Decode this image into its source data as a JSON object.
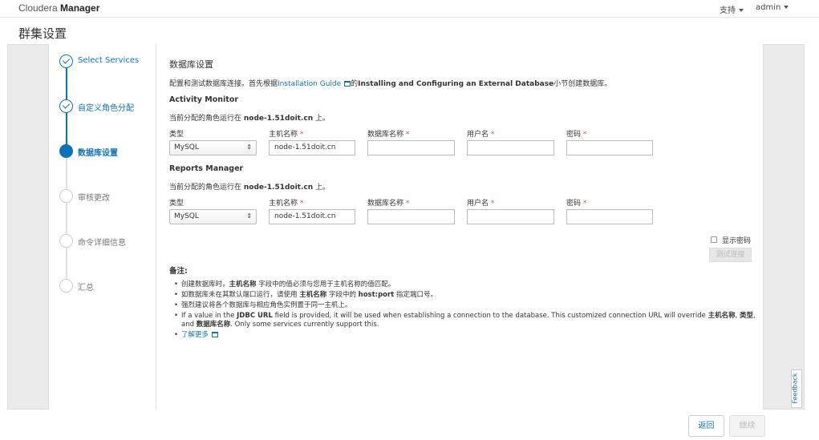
{
  "header": {
    "brand_light": "Cloudera",
    "brand_bold": "Manager",
    "support_label": "支持",
    "user_label": "admin"
  },
  "page_title": "群集设置",
  "steps": [
    {
      "label": "Select Services",
      "state": "done"
    },
    {
      "label": "自定义角色分配",
      "state": "done"
    },
    {
      "label": "数据库设置",
      "state": "active"
    },
    {
      "label": "审核更改",
      "state": "pending"
    },
    {
      "label": "命令详细信息",
      "state": "pending"
    },
    {
      "label": "汇总",
      "state": "pending"
    }
  ],
  "main": {
    "heading": "数据库设置",
    "intro_prefix": "配置和测试数据库连接。首先根据",
    "intro_link": "Installation Guide",
    "intro_mid": "的",
    "intro_bold": "Installing and Configuring an External Database",
    "intro_suffix": "小节创建数据库。",
    "field_labels": {
      "type": "类型",
      "host": "主机名称",
      "db_name": "数据库名称",
      "username": "用户名",
      "password": "密码",
      "required_mark": "*"
    },
    "sections": [
      {
        "title": "Activity Monitor",
        "host_prefix": "当前分配的角色运行在",
        "host_node": "node-1.51doit.cn",
        "host_suffix": "上。",
        "type_value": "MySQL",
        "host_value": "node-1.51doit.cn",
        "db_value": "",
        "user_value": "",
        "password_value": ""
      },
      {
        "title": "Reports Manager",
        "host_prefix": "当前分配的角色运行在",
        "host_node": "node-1.51doit.cn",
        "host_suffix": "上。",
        "type_value": "MySQL",
        "host_value": "node-1.51doit.cn",
        "db_value": "",
        "user_value": "",
        "password_value": ""
      }
    ],
    "show_password_label": "显示密码",
    "test_connection_label": "测试连接",
    "notes_title": "备注:",
    "notes": {
      "n1_a": "创建数据库时，",
      "n1_b": "主机名称",
      "n1_c": "字段中的值必须与您用于主机名称的值匹配。",
      "n2_a": "如数据库未在其默认端口运行，请使用",
      "n2_b": "主机名称",
      "n2_c": "字段中的",
      "n2_d": "host:port",
      "n2_e": "指定端口号。",
      "n3": "强烈建议将各个数据库与相应角色实例置于同一主机上。",
      "n4_a": "If a value in the",
      "n4_b": "JDBC URL",
      "n4_c": "field is provided, it will be used when establishing a connection to the database. This customized connection URL will override",
      "n4_d": "主机名称",
      "n4_e": ",",
      "n4_f": "类型",
      "n4_g": ",",
      "n4_h": "and",
      "n4_i": "数据库名称",
      "n4_j": ". Only some services currently support this.",
      "learn_more": "了解更多"
    }
  },
  "feedback_label": "Feedback",
  "footer": {
    "back_label": "返回",
    "continue_label": "继续"
  },
  "colors": {
    "accent": "#0b73ba",
    "required": "#d9534f",
    "frame_bg": "#ebebeb"
  }
}
